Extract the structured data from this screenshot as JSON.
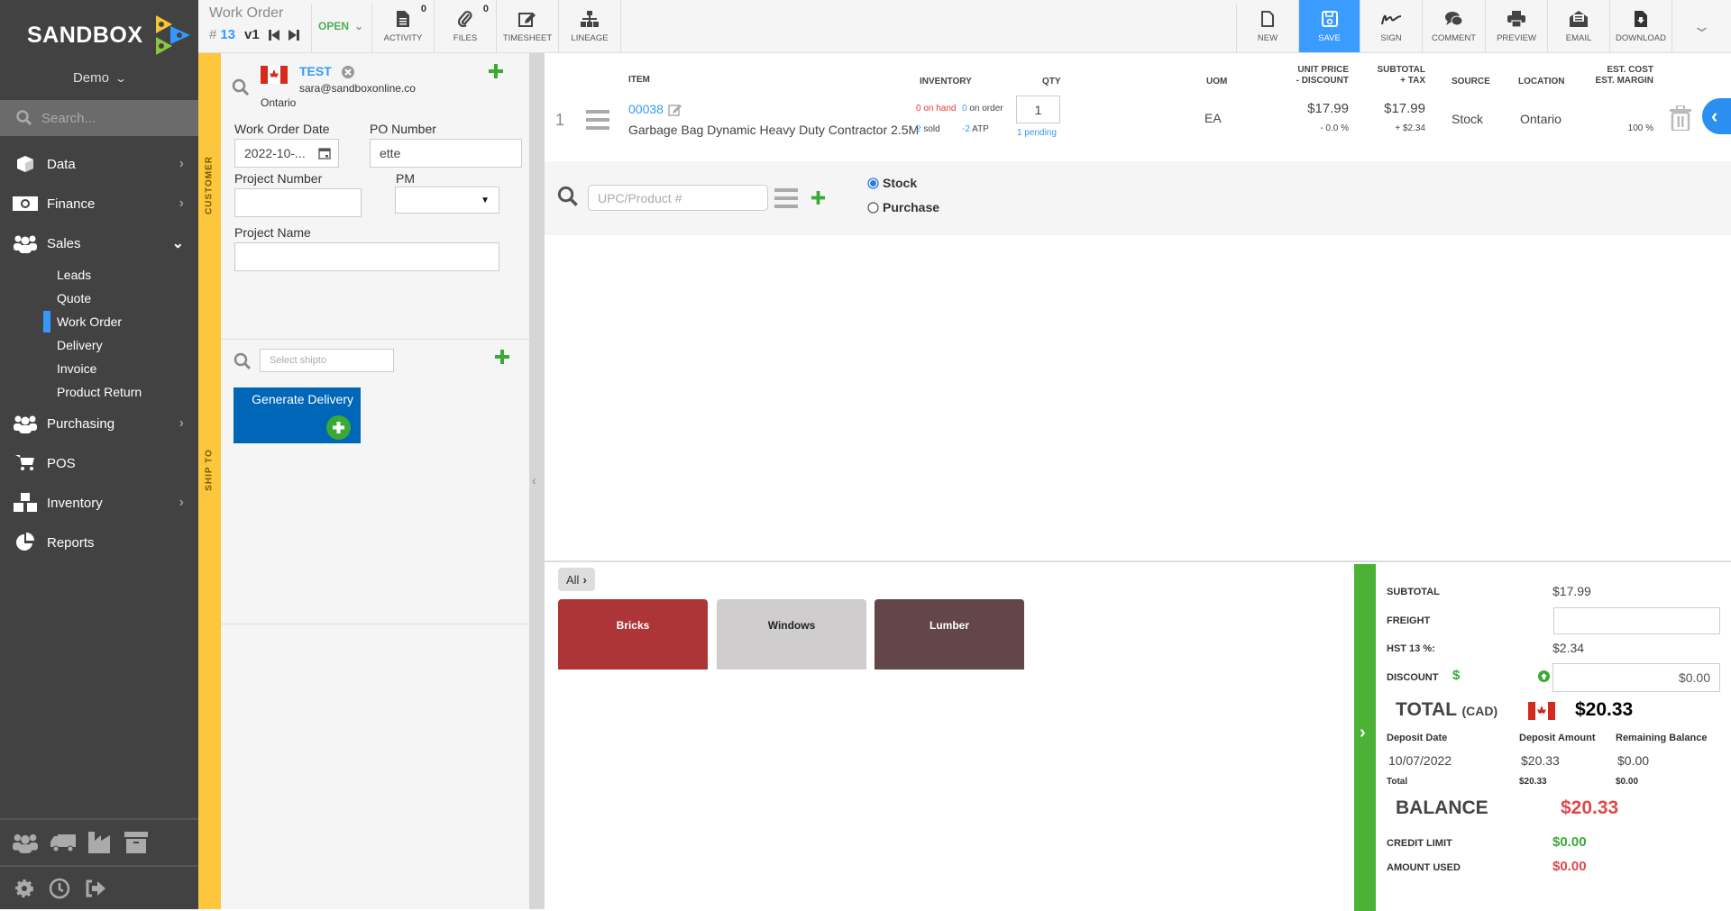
{
  "sidebar": {
    "brand": "SANDBOX",
    "account": "Demo",
    "search_placeholder": "Search...",
    "items": [
      {
        "label": "Data",
        "icon": "cube-icon",
        "arrow": "right"
      },
      {
        "label": "Finance",
        "icon": "money-icon",
        "arrow": "right"
      },
      {
        "label": "Sales",
        "icon": "users-icon",
        "arrow": "down"
      },
      {
        "label": "Purchasing",
        "icon": "users-icon",
        "arrow": "right"
      },
      {
        "label": "POS",
        "icon": "cart-icon",
        "arrow": ""
      },
      {
        "label": "Inventory",
        "icon": "cubes-icon",
        "arrow": "right"
      },
      {
        "label": "Reports",
        "icon": "pie-chart-icon",
        "arrow": ""
      }
    ],
    "sales_sub": [
      "Leads",
      "Quote",
      "Work Order",
      "Delivery",
      "Invoice",
      "Product Return"
    ],
    "active_sub": "Work Order"
  },
  "header": {
    "title": "Work Order",
    "hash": "#",
    "number": "13",
    "version": "v1",
    "status": "OPEN",
    "tools": [
      {
        "label": "ACTIVITY",
        "count": "0"
      },
      {
        "label": "FILES",
        "count": "0"
      },
      {
        "label": "TIMESHEET"
      },
      {
        "label": "LINEAGE"
      }
    ],
    "actions": [
      "NEW",
      "SAVE",
      "SIGN",
      "COMMENT",
      "PREVIEW",
      "EMAIL",
      "DOWNLOAD"
    ]
  },
  "customer": {
    "section_label": "CUSTOMER",
    "name": "TEST",
    "email": "sara@sandboxonline.co",
    "region": "Ontario",
    "fields": {
      "wo_date_label": "Work Order Date",
      "wo_date_value": "2022-10-...",
      "po_label": "PO Number",
      "po_value": "ette",
      "project_number_label": "Project Number",
      "project_number_value": "",
      "pm_label": "PM",
      "pm_value": "",
      "project_name_label": "Project Name",
      "project_name_value": ""
    }
  },
  "shipto": {
    "section_label": "SHIP TO",
    "placeholder": "Select shipto",
    "generate_label": "Generate Delivery"
  },
  "table": {
    "headers": {
      "item": "ITEM",
      "inventory": "INVENTORY",
      "qty": "QTY",
      "uom": "UOM",
      "unit_price": "UNIT PRICE",
      "discount": "- DISCOUNT",
      "subtotal": "SUBTOTAL",
      "tax": "+ TAX",
      "source": "SOURCE",
      "location": "LOCATION",
      "est_cost": "EST. COST",
      "est_margin": "EST. MARGIN"
    },
    "rows": [
      {
        "line": "1",
        "code": "00038",
        "description": "Garbage Bag Dynamic Heavy Duty Contractor 2.5M",
        "on_hand": "0",
        "on_hand_label": "on hand",
        "on_order": "0",
        "on_order_label": "on order",
        "sold": "2",
        "sold_label": "sold",
        "atp": "-2",
        "atp_label": "ATP",
        "qty": "1",
        "pending": "1",
        "pending_label": "pending",
        "uom": "EA",
        "unit_price": "$17.99",
        "discount": "- 0.0 %",
        "subtotal": "$17.99",
        "tax": "+ $2.34",
        "source": "Stock",
        "location": "Ontario",
        "margin": "100 %"
      }
    ]
  },
  "add_product": {
    "placeholder": "UPC/Product #",
    "options": [
      "Stock",
      "Purchase"
    ],
    "selected": "Stock"
  },
  "categories": {
    "breadcrumb": "All",
    "tiles": [
      {
        "label": "Bricks",
        "color": "#ad3537",
        "text": "#ffffff"
      },
      {
        "label": "Windows",
        "color": "#cfcdcd",
        "text": "#222222"
      },
      {
        "label": "Lumber",
        "color": "#634647",
        "text": "#ffffff"
      }
    ]
  },
  "summary": {
    "subtotal_label": "SUBTOTAL",
    "subtotal": "$17.99",
    "freight_label": "FREIGHT",
    "freight": "",
    "tax_label": "HST 13 %:",
    "tax": "$2.34",
    "discount_label": "DISCOUNT",
    "discount_symbol": "$",
    "discount": "$0.00",
    "total_label": "TOTAL",
    "currency": "(CAD)",
    "total": "$20.33",
    "deposit_headers": [
      "Deposit Date",
      "Deposit Amount",
      "Remaining Balance"
    ],
    "deposit_row": [
      "10/07/2022",
      "$20.33",
      "$0.00"
    ],
    "deposit_total": [
      "Total",
      "$20.33",
      "$0.00"
    ],
    "balance_label": "BALANCE",
    "balance": "$20.33",
    "credit_limit_label": "CREDIT LIMIT",
    "credit_limit": "$0.00",
    "amount_used_label": "AMOUNT USED",
    "amount_used": "$0.00",
    "colors": {
      "balance": "#e04848",
      "credit": "#3aa935",
      "accent": "#3b9cff",
      "green_bar": "#4cb236"
    }
  }
}
